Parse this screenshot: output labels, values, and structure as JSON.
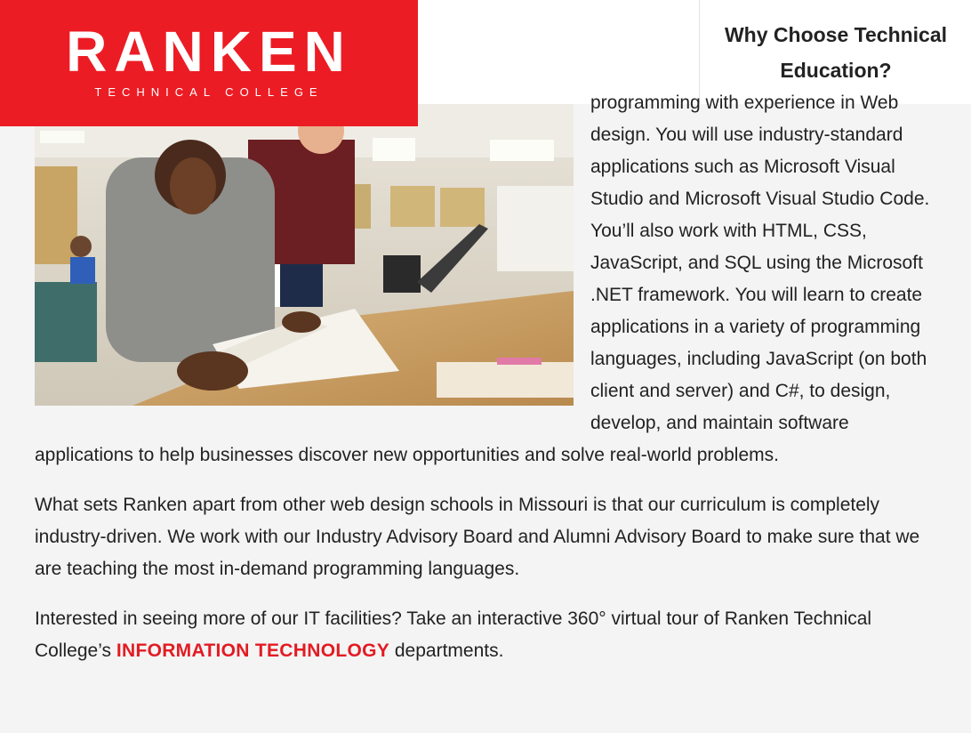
{
  "header": {
    "logo_word": "RANKEN",
    "logo_tag": "TECHNICAL COLLEGE",
    "why_link": "Why Choose Technical Education?"
  },
  "colors": {
    "brand_red": "#ec1c24",
    "link_red": "#e31b23",
    "page_bg": "#f4f4f4"
  },
  "photo": {
    "alt": "Student reading a textbook in a computer lab while an instructor looks on"
  },
  "body": {
    "p1": "programming with experience in Web design. You will use industry-standard applications such as Microsoft Visual Studio and Microsoft Visual Studio Code. You’ll also work with HTML, CSS, JavaScript, and SQL using the Microsoft .NET framework. You will learn to create applications in a variety of programming languages, including JavaScript (on both client and server) and C#, to design, develop, and maintain software applications to help businesses discover new opportunities and solve real-world problems.",
    "p2": "What sets Ranken apart from other web design schools in Missouri is that our curriculum is completely industry-driven. We work with our Industry Advisory Board and Alumni Advisory Board to make sure that we are teaching the most in-demand programming languages.",
    "p3_before": "Interested in seeing more of our IT facilities? Take an interactive 360° virtual tour of Ranken Technical College’s ",
    "p3_link": "INFORMATION TECHNOLOGY",
    "p3_after": " departments."
  }
}
